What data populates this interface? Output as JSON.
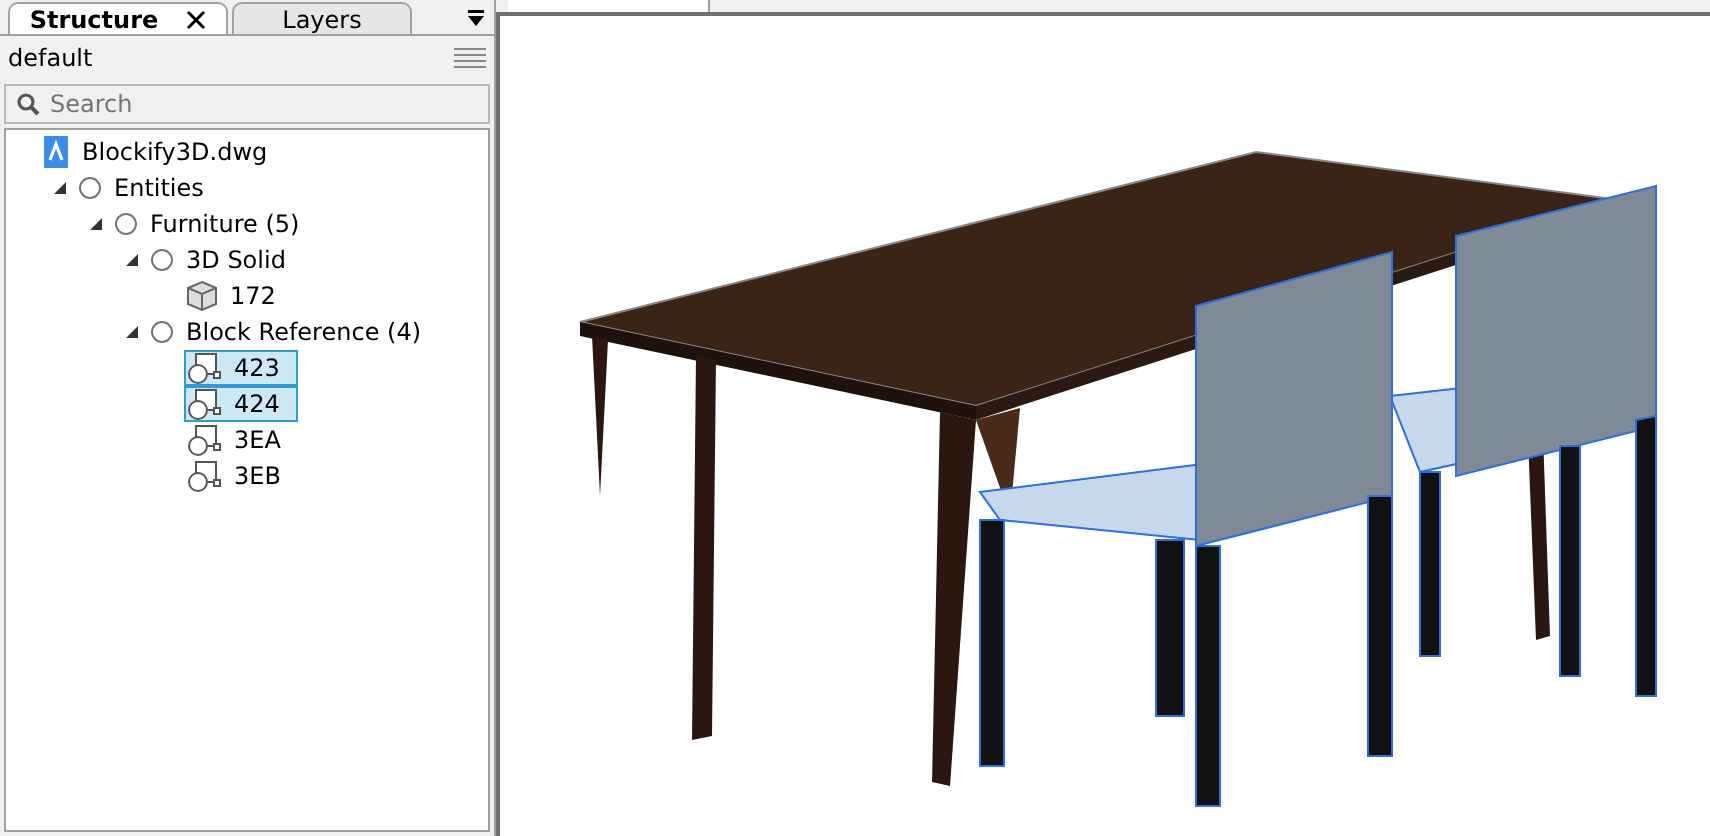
{
  "panel_tabs": [
    {
      "label": "Structure",
      "selected": true
    },
    {
      "label": "Layers",
      "selected": false
    }
  ],
  "structure_name": "default",
  "search": {
    "placeholder": "Search"
  },
  "tree": [
    {
      "label": "Blockify3D.dwg",
      "kind": "file",
      "selected": false,
      "children": [
        {
          "label": "Entities",
          "kind": "group",
          "expanded": true,
          "selected": false,
          "children": [
            {
              "label": "Furniture (5)",
              "kind": "group",
              "expanded": true,
              "selected": false,
              "children": [
                {
                  "label": "3D Solid",
                  "kind": "group",
                  "expanded": true,
                  "selected": false,
                  "children": [
                    {
                      "label": "172",
                      "kind": "solid",
                      "selected": false
                    }
                  ]
                },
                {
                  "label": "Block Reference (4)",
                  "kind": "group",
                  "expanded": true,
                  "selected": false,
                  "children": [
                    {
                      "label": "423",
                      "kind": "block",
                      "selected": true
                    },
                    {
                      "label": "424",
                      "kind": "block",
                      "selected": true
                    },
                    {
                      "label": "3EA",
                      "kind": "block",
                      "selected": false
                    },
                    {
                      "label": "3EB",
                      "kind": "block",
                      "selected": false
                    }
                  ]
                }
              ]
            }
          ]
        }
      ]
    }
  ]
}
